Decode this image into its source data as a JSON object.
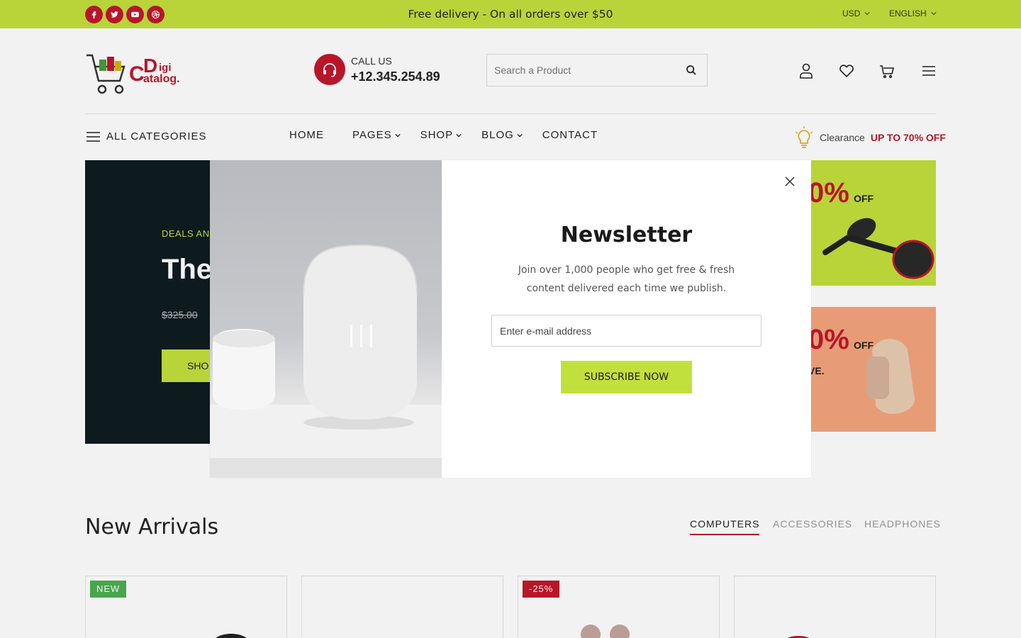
{
  "topbar": {
    "promo": "Free delivery - On all orders over $50",
    "currency": "USD",
    "language": "ENGLISH",
    "social": [
      "facebook-icon",
      "twitter-icon",
      "youtube-icon",
      "dribbble-icon"
    ],
    "bg": "#c2e03b"
  },
  "header": {
    "logo_text": "Digi Catalog.",
    "call_label": "CALL US",
    "call_number": "+12.345.254.89",
    "search_placeholder": "Search a Product",
    "icons": [
      "user-icon",
      "heart-icon",
      "cart-icon",
      "menu-icon"
    ]
  },
  "nav": {
    "all_categories": "ALL CATEGORIES",
    "items": [
      {
        "label": "HOME",
        "dropdown": false
      },
      {
        "label": "PAGES",
        "dropdown": true
      },
      {
        "label": "SHOP",
        "dropdown": true
      },
      {
        "label": "BLOG",
        "dropdown": true
      },
      {
        "label": "CONTACT",
        "dropdown": false
      }
    ],
    "clearance_label": "Clearance",
    "clearance_offer": "UP TO 70% OFF"
  },
  "hero": {
    "deals": "DEALS AND",
    "title": "The",
    "price": "$325.00",
    "button": "SHO"
  },
  "banners": [
    {
      "percent": "0%",
      "off": "OFF",
      "bg": "#c2e03b"
    },
    {
      "percent": "0%",
      "off": "OFF",
      "sub": "VE.",
      "bg": "#f4a57d"
    }
  ],
  "arrivals": {
    "title": "New Arrivals",
    "tabs": [
      {
        "label": "COMPUTERS",
        "active": true
      },
      {
        "label": "ACCESSORIES",
        "active": false
      },
      {
        "label": "HEADPHONES",
        "active": false
      }
    ],
    "cards": [
      {
        "badge": "NEW",
        "badge_color": "#4caf50"
      },
      {
        "badge": ""
      },
      {
        "badge": "-25%",
        "badge_color": "#c3172c"
      },
      {
        "badge": ""
      }
    ]
  },
  "modal": {
    "title": "Newsletter",
    "description": "Join over 1,000 people who get free & fresh content delivered each time we publish.",
    "email_placeholder": "Enter e-mail address",
    "button": "SUBSCRIBE NOW",
    "accent": "#c2e03b"
  }
}
